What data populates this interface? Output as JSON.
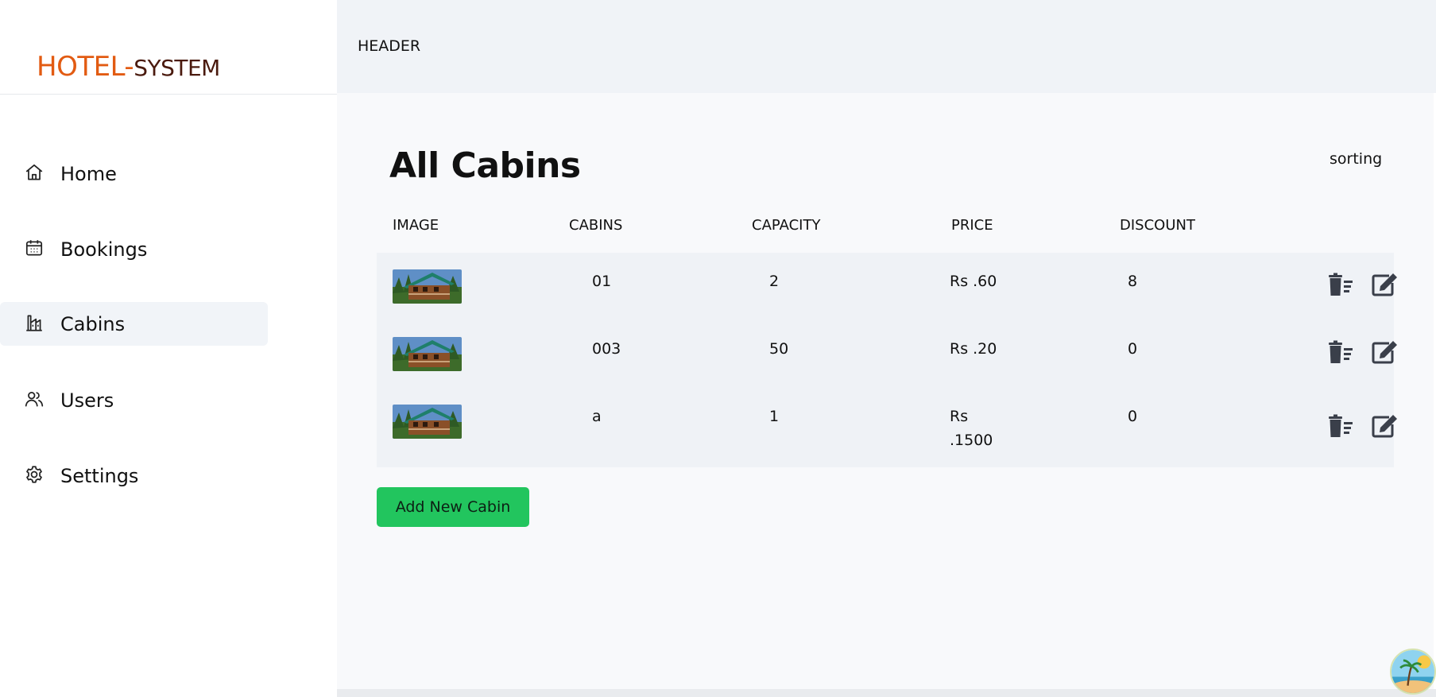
{
  "brand": {
    "part1": "HOTEL-",
    "part2": "SYSTEM"
  },
  "sidebar": {
    "items": [
      {
        "label": "Home",
        "icon": "home-icon",
        "active": false
      },
      {
        "label": "Bookings",
        "icon": "calendar-icon",
        "active": false
      },
      {
        "label": "Cabins",
        "icon": "cabin-building-icon",
        "active": true
      },
      {
        "label": "Users",
        "icon": "users-icon",
        "active": false
      },
      {
        "label": "Settings",
        "icon": "gear-icon",
        "active": false
      }
    ]
  },
  "header": {
    "title": "HEADER"
  },
  "main": {
    "title": "All Cabins",
    "sorting": "sorting",
    "columns": [
      "IMAGE",
      "CABINS",
      "CAPACITY",
      "PRICE",
      "DISCOUNT"
    ],
    "rows": [
      {
        "cabin": "01",
        "capacity": "2",
        "price": "Rs .60",
        "discount": "8"
      },
      {
        "cabin": "003",
        "capacity": "50",
        "price": "Rs .20",
        "discount": "0"
      },
      {
        "cabin": "a",
        "capacity": "1",
        "price": "Rs .1500",
        "discount": "0"
      }
    ],
    "add_button": "Add New Cabin"
  },
  "colors": {
    "brand_orange": "#e25b12",
    "brand_dark": "#4a1a0e",
    "add_button": "#22c55e",
    "active_nav_bg": "#f1f4f8",
    "table_row_bg": "#eff2f6"
  }
}
